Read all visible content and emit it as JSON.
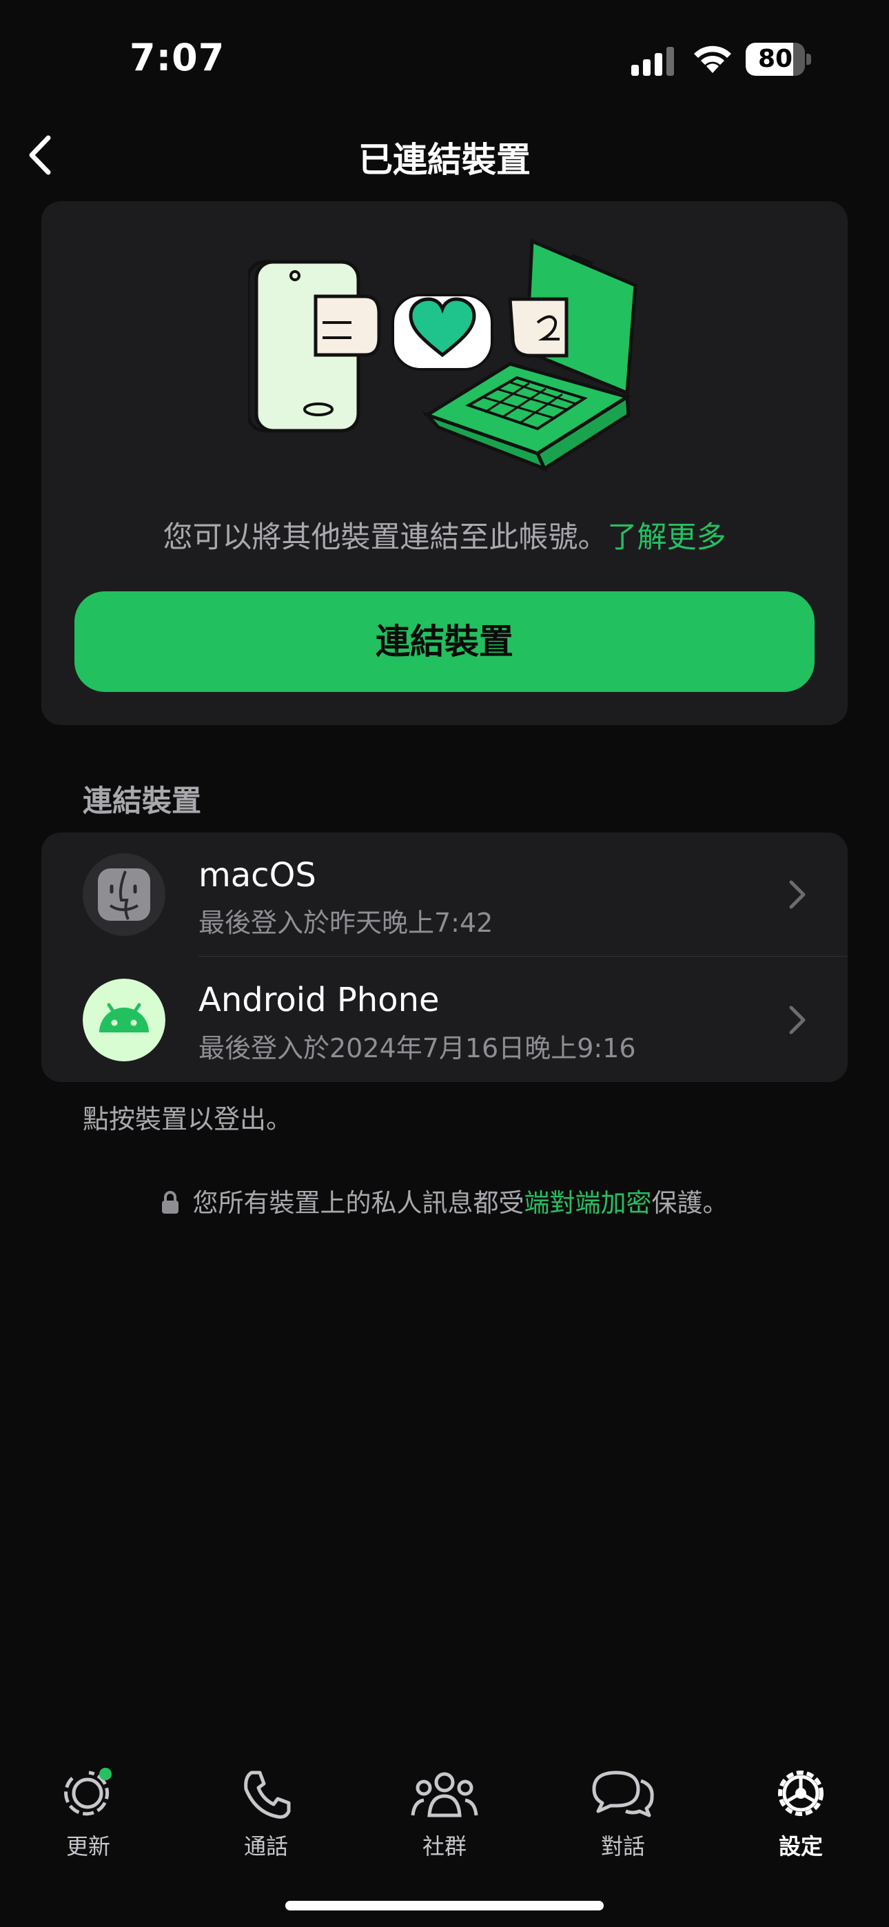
{
  "status_bar": {
    "time": "7:07",
    "battery_level": "80",
    "battery_fraction": 0.8
  },
  "header": {
    "title": "已連結裝置"
  },
  "hero": {
    "info_text": "您可以將其他裝置連結至此帳號。",
    "learn_more": "了解更多",
    "link_button_label": "連結裝置"
  },
  "devices": {
    "section_label": "連結裝置",
    "items": [
      {
        "name": "macOS",
        "last_login": "最後登入於昨天晚上7:42",
        "icon": "finder-icon"
      },
      {
        "name": "Android Phone",
        "last_login": "最後登入於2024年7月16日晚上9:16",
        "icon": "android-icon"
      }
    ],
    "hint": "點按裝置以登出。"
  },
  "encryption": {
    "text_before": "您所有裝置上的私人訊息都受",
    "link": "端對端加密",
    "text_after": "保護。"
  },
  "tab_bar": {
    "items": [
      {
        "label": "更新",
        "icon": "updates-icon",
        "active": false,
        "has_badge": true
      },
      {
        "label": "通話",
        "icon": "phone-icon",
        "active": false
      },
      {
        "label": "社群",
        "icon": "communities-icon",
        "active": false
      },
      {
        "label": "對話",
        "icon": "chats-icon",
        "active": false
      },
      {
        "label": "設定",
        "icon": "settings-icon",
        "active": true
      }
    ]
  },
  "colors": {
    "accent": "#25c061",
    "button": "#22c05e",
    "background": "#0b0b0b",
    "card": "#1c1c1e"
  }
}
